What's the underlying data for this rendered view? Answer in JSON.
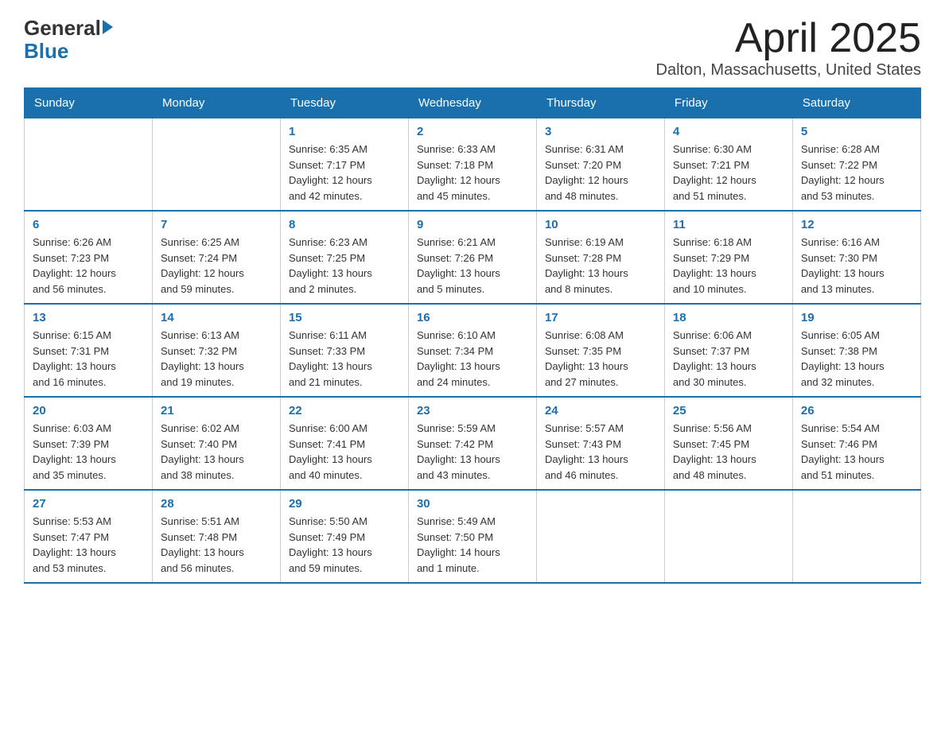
{
  "logo": {
    "general": "General",
    "blue": "Blue",
    "arrow": "▶"
  },
  "title": "April 2025",
  "subtitle": "Dalton, Massachusetts, United States",
  "headers": [
    "Sunday",
    "Monday",
    "Tuesday",
    "Wednesday",
    "Thursday",
    "Friday",
    "Saturday"
  ],
  "weeks": [
    [
      {
        "day": "",
        "info": ""
      },
      {
        "day": "",
        "info": ""
      },
      {
        "day": "1",
        "info": "Sunrise: 6:35 AM\nSunset: 7:17 PM\nDaylight: 12 hours\nand 42 minutes."
      },
      {
        "day": "2",
        "info": "Sunrise: 6:33 AM\nSunset: 7:18 PM\nDaylight: 12 hours\nand 45 minutes."
      },
      {
        "day": "3",
        "info": "Sunrise: 6:31 AM\nSunset: 7:20 PM\nDaylight: 12 hours\nand 48 minutes."
      },
      {
        "day": "4",
        "info": "Sunrise: 6:30 AM\nSunset: 7:21 PM\nDaylight: 12 hours\nand 51 minutes."
      },
      {
        "day": "5",
        "info": "Sunrise: 6:28 AM\nSunset: 7:22 PM\nDaylight: 12 hours\nand 53 minutes."
      }
    ],
    [
      {
        "day": "6",
        "info": "Sunrise: 6:26 AM\nSunset: 7:23 PM\nDaylight: 12 hours\nand 56 minutes."
      },
      {
        "day": "7",
        "info": "Sunrise: 6:25 AM\nSunset: 7:24 PM\nDaylight: 12 hours\nand 59 minutes."
      },
      {
        "day": "8",
        "info": "Sunrise: 6:23 AM\nSunset: 7:25 PM\nDaylight: 13 hours\nand 2 minutes."
      },
      {
        "day": "9",
        "info": "Sunrise: 6:21 AM\nSunset: 7:26 PM\nDaylight: 13 hours\nand 5 minutes."
      },
      {
        "day": "10",
        "info": "Sunrise: 6:19 AM\nSunset: 7:28 PM\nDaylight: 13 hours\nand 8 minutes."
      },
      {
        "day": "11",
        "info": "Sunrise: 6:18 AM\nSunset: 7:29 PM\nDaylight: 13 hours\nand 10 minutes."
      },
      {
        "day": "12",
        "info": "Sunrise: 6:16 AM\nSunset: 7:30 PM\nDaylight: 13 hours\nand 13 minutes."
      }
    ],
    [
      {
        "day": "13",
        "info": "Sunrise: 6:15 AM\nSunset: 7:31 PM\nDaylight: 13 hours\nand 16 minutes."
      },
      {
        "day": "14",
        "info": "Sunrise: 6:13 AM\nSunset: 7:32 PM\nDaylight: 13 hours\nand 19 minutes."
      },
      {
        "day": "15",
        "info": "Sunrise: 6:11 AM\nSunset: 7:33 PM\nDaylight: 13 hours\nand 21 minutes."
      },
      {
        "day": "16",
        "info": "Sunrise: 6:10 AM\nSunset: 7:34 PM\nDaylight: 13 hours\nand 24 minutes."
      },
      {
        "day": "17",
        "info": "Sunrise: 6:08 AM\nSunset: 7:35 PM\nDaylight: 13 hours\nand 27 minutes."
      },
      {
        "day": "18",
        "info": "Sunrise: 6:06 AM\nSunset: 7:37 PM\nDaylight: 13 hours\nand 30 minutes."
      },
      {
        "day": "19",
        "info": "Sunrise: 6:05 AM\nSunset: 7:38 PM\nDaylight: 13 hours\nand 32 minutes."
      }
    ],
    [
      {
        "day": "20",
        "info": "Sunrise: 6:03 AM\nSunset: 7:39 PM\nDaylight: 13 hours\nand 35 minutes."
      },
      {
        "day": "21",
        "info": "Sunrise: 6:02 AM\nSunset: 7:40 PM\nDaylight: 13 hours\nand 38 minutes."
      },
      {
        "day": "22",
        "info": "Sunrise: 6:00 AM\nSunset: 7:41 PM\nDaylight: 13 hours\nand 40 minutes."
      },
      {
        "day": "23",
        "info": "Sunrise: 5:59 AM\nSunset: 7:42 PM\nDaylight: 13 hours\nand 43 minutes."
      },
      {
        "day": "24",
        "info": "Sunrise: 5:57 AM\nSunset: 7:43 PM\nDaylight: 13 hours\nand 46 minutes."
      },
      {
        "day": "25",
        "info": "Sunrise: 5:56 AM\nSunset: 7:45 PM\nDaylight: 13 hours\nand 48 minutes."
      },
      {
        "day": "26",
        "info": "Sunrise: 5:54 AM\nSunset: 7:46 PM\nDaylight: 13 hours\nand 51 minutes."
      }
    ],
    [
      {
        "day": "27",
        "info": "Sunrise: 5:53 AM\nSunset: 7:47 PM\nDaylight: 13 hours\nand 53 minutes."
      },
      {
        "day": "28",
        "info": "Sunrise: 5:51 AM\nSunset: 7:48 PM\nDaylight: 13 hours\nand 56 minutes."
      },
      {
        "day": "29",
        "info": "Sunrise: 5:50 AM\nSunset: 7:49 PM\nDaylight: 13 hours\nand 59 minutes."
      },
      {
        "day": "30",
        "info": "Sunrise: 5:49 AM\nSunset: 7:50 PM\nDaylight: 14 hours\nand 1 minute."
      },
      {
        "day": "",
        "info": ""
      },
      {
        "day": "",
        "info": ""
      },
      {
        "day": "",
        "info": ""
      }
    ]
  ]
}
